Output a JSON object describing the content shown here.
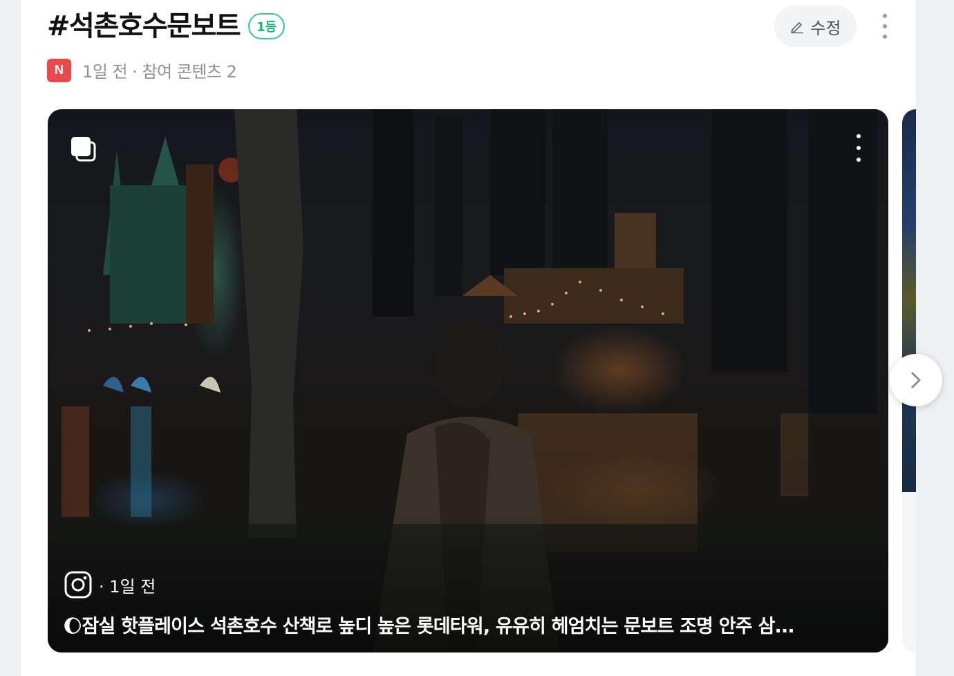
{
  "header": {
    "title": "#석촌호수문보트",
    "rank_badge": "1등",
    "edit_label": "수정",
    "source_badge": "N",
    "meta": "1일 전 · 참여 콘텐츠 2"
  },
  "content_card": {
    "platform_icon": "instagram-icon",
    "time": "· 1일 전",
    "title": "🌔잠실 핫플레이스 석촌호수 산책로 높디 높은 롯데타워, 유유히 헤엄치는 문보트 조명 안주 삼..."
  },
  "icons": {
    "edit": "pencil-icon",
    "more": "more-vertical-icon",
    "gallery": "gallery-stack-icon",
    "next": "chevron-right-icon"
  },
  "colors": {
    "rank_badge": "#2ecb8c",
    "source_badge": "#e9494b",
    "meta_text": "#8d9096"
  }
}
